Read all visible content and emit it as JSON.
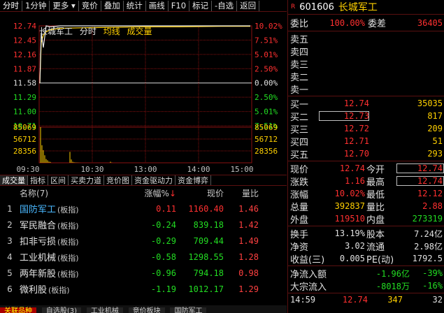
{
  "toolbar": {
    "items": [
      "分时",
      "1分钟",
      "更多",
      "竞价",
      "叠加",
      "统计",
      "画线",
      "F10",
      "标记",
      "-自选",
      "返回"
    ]
  },
  "chart_data": {
    "type": "line",
    "title": "长城军工",
    "legend": [
      "分时",
      "均线",
      "成交量"
    ],
    "price_axis": [
      "12.74",
      "12.45",
      "12.16",
      "11.87",
      "11.58",
      "11.29",
      "11.00",
      "10.71"
    ],
    "pct_axis": [
      "10.02%",
      "7.51%",
      "5.01%",
      "2.50%",
      "0.00%",
      "2.50%",
      "5.01%",
      "7.51%"
    ],
    "vol_axis": [
      "85069",
      "56712",
      "28356"
    ],
    "vol_axis_right": [
      "85069",
      "56712",
      "28356"
    ],
    "x_labels": [
      "09:30",
      "10:30",
      "13:00",
      "14:00",
      "15:00"
    ],
    "prev_close": 11.58,
    "price": [
      11.58,
      12.6,
      12.3,
      12.74,
      12.72,
      12.74,
      12.74,
      12.74,
      12.74,
      12.74,
      12.74,
      12.74
    ],
    "avg": [
      11.58,
      12.4,
      12.55,
      12.62,
      12.66,
      12.69,
      12.7,
      12.71,
      12.72,
      12.72,
      12.73,
      12.73
    ],
    "volume": [
      85069,
      42000,
      30000,
      18000,
      9000,
      6000,
      3000,
      2000,
      26000,
      8000,
      2500,
      1200,
      900,
      600,
      400,
      300,
      2500,
      500
    ],
    "ylim": [
      10.71,
      12.74
    ],
    "vol_max": 85069
  },
  "tabs": [
    "成交量",
    "指标",
    "区间",
    "买卖力道",
    "竞价图",
    "资金驱动力",
    "资金博弈"
  ],
  "list": {
    "headers": {
      "name": "名称",
      "count": "(7)",
      "pct": "涨幅%",
      "price": "现价",
      "ratio": "量比"
    },
    "rows": [
      {
        "idx": "1",
        "name": "国防军工",
        "tag": "(板指)",
        "pct": "0.11",
        "price": "1160.40",
        "ratio": "1.46",
        "dir": "up",
        "highlight": true
      },
      {
        "idx": "2",
        "name": "军民融合",
        "tag": "(板指)",
        "pct": "-0.24",
        "price": "839.18",
        "ratio": "1.42",
        "dir": "down"
      },
      {
        "idx": "3",
        "name": "扣非亏损",
        "tag": "(板指)",
        "pct": "-0.29",
        "price": "709.44",
        "ratio": "1.49",
        "dir": "down"
      },
      {
        "idx": "4",
        "name": "工业机械",
        "tag": "(板指)",
        "pct": "-0.58",
        "price": "1298.55",
        "ratio": "1.28",
        "dir": "down"
      },
      {
        "idx": "5",
        "name": "两年新股",
        "tag": "(板指)",
        "pct": "-0.96",
        "price": "794.18",
        "ratio": "0.98",
        "dir": "down"
      },
      {
        "idx": "6",
        "name": "微利股",
        "tag": "(板指)",
        "pct": "-1.19",
        "price": "1012.17",
        "ratio": "1.29",
        "dir": "down"
      }
    ]
  },
  "bottom_tabs": [
    "关联品种",
    "自选股(3)",
    "工业机械",
    "竞价板块",
    "国防军工"
  ],
  "stock": {
    "badge": "R",
    "code": "601606",
    "name": "长城军工",
    "weibi_label": "委比",
    "weibi": "100.00%",
    "weicha_label": "委差",
    "weicha": "36405",
    "sells": [
      {
        "l": "卖五"
      },
      {
        "l": "卖四"
      },
      {
        "l": "卖三"
      },
      {
        "l": "卖二"
      },
      {
        "l": "卖一"
      }
    ],
    "buys": [
      {
        "l": "买一",
        "p": "12.74",
        "v": "35035"
      },
      {
        "l": "买二",
        "p": "12.73",
        "v": "817"
      },
      {
        "l": "买三",
        "p": "12.72",
        "v": "209"
      },
      {
        "l": "买四",
        "p": "12.71",
        "v": "51"
      },
      {
        "l": "买五",
        "p": "12.70",
        "v": "293"
      }
    ],
    "quote": [
      {
        "l1": "现价",
        "v1": "12.74",
        "c1": "red",
        "l2": "今开",
        "v2": "12.74",
        "c2": "red",
        "box": true
      },
      {
        "l1": "涨跌",
        "v1": "1.16",
        "c1": "red",
        "l2": "最高",
        "v2": "12.74",
        "c2": "red",
        "box": true
      },
      {
        "l1": "涨幅",
        "v1": "10.02%",
        "c1": "red",
        "l2": "最低",
        "v2": "12.12",
        "c2": "red"
      },
      {
        "l1": "总量",
        "v1": "392837",
        "c1": "y",
        "l2": "量比",
        "v2": "2.88",
        "c2": "red"
      },
      {
        "l1": "外盘",
        "v1": "119510",
        "c1": "red",
        "l2": "内盘",
        "v2": "273319",
        "c2": "grn"
      }
    ],
    "fin": [
      {
        "l1": "换手",
        "v1": "13.19%",
        "l2": "股本",
        "v2": "7.24亿"
      },
      {
        "l1": "净资",
        "v1": "3.02",
        "l2": "流通",
        "v2": "2.98亿"
      },
      {
        "l1": "收益(三)",
        "v1": "0.005",
        "l2": "PE(动)",
        "v2": "1792.5"
      }
    ],
    "flow": [
      {
        "l": "净流入额",
        "v": "-1.96亿",
        "v2": "-39%"
      },
      {
        "l": "大宗流入",
        "v": "-8018万",
        "v2": "-16%"
      }
    ],
    "last": {
      "t": "14:59",
      "p": "12.74",
      "v": "347",
      "n": "32"
    }
  }
}
